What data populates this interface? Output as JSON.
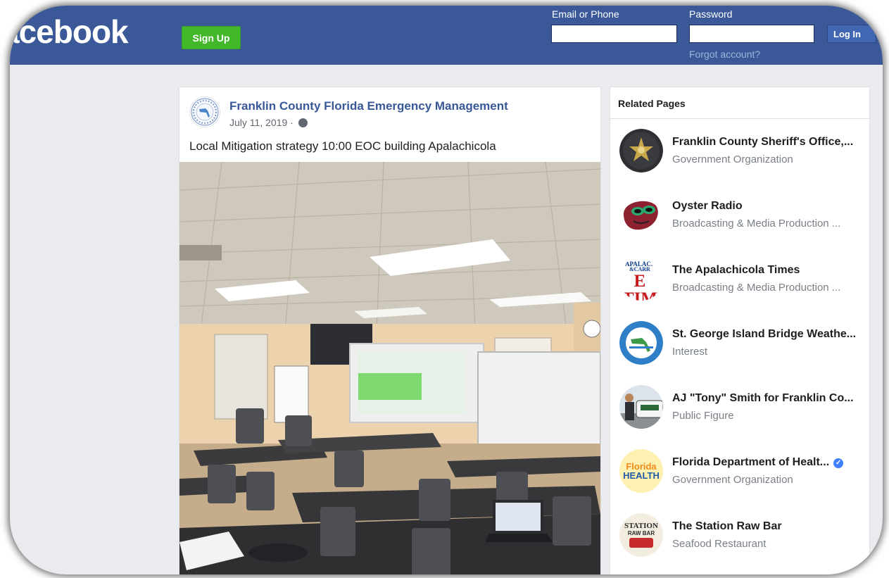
{
  "header": {
    "logo": "acebook",
    "signup_label": "Sign Up",
    "email_label": "Email or Phone",
    "email_value": "",
    "password_label": "Password",
    "password_value": "",
    "login_label": "Log In",
    "forgot_label": "Forgot account?"
  },
  "post": {
    "page_name": "Franklin County Florida Emergency Management",
    "date": "July 11, 2019 ·",
    "text": "Local Mitigation strategy 10:00 EOC building Apalachicola"
  },
  "related": {
    "title": "Related Pages",
    "items": [
      {
        "name": "Franklin County Sheriff's Office,...",
        "category": "Government Organization"
      },
      {
        "name": "Oyster Radio",
        "category": "Broadcasting & Media Production ..."
      },
      {
        "name": "The Apalachicola Times",
        "category": "Broadcasting & Media Production ..."
      },
      {
        "name": "St. George Island Bridge Weathe...",
        "category": "Interest"
      },
      {
        "name": "AJ \"Tony\" Smith for Franklin Co...",
        "category": "Public Figure"
      },
      {
        "name": "Florida Department of Healt...",
        "category": "Government Organization"
      },
      {
        "name": "The Station Raw Bar",
        "category": "Seafood Restaurant"
      }
    ],
    "thumb_texts": {
      "times_top": "APALAC.",
      "times_mid": "&CARR",
      "times_big": "E TIM",
      "health_1": "Florida",
      "health_2": "HEALTH",
      "station_top": "STATION",
      "station_sub": "RAW BAR"
    }
  }
}
